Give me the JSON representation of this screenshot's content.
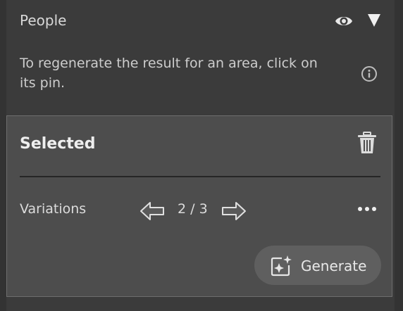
{
  "section": {
    "title": "People",
    "info_text": "To regenerate the result for an area, click on its pin."
  },
  "selected": {
    "title": "Selected",
    "variations_label": "Variations",
    "counter": "2 / 3",
    "generate_label": "Generate"
  },
  "icons": {
    "visibility": "eye-icon",
    "collapse": "triangle-down-icon",
    "info": "info-icon",
    "delete": "trash-icon",
    "prev": "arrow-left-icon",
    "next": "arrow-right-icon",
    "more": "ellipsis-icon",
    "generate": "sparkle-generate-icon"
  },
  "colors": {
    "background": "#3b3b3b",
    "card": "#4d4d4d",
    "button": "#5f5f5f"
  }
}
